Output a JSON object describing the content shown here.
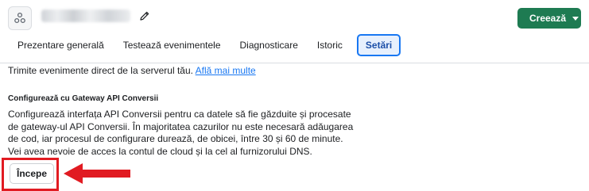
{
  "header": {
    "app_icon": "dataset-hub-icon",
    "edit_icon": "pencil-icon",
    "create_label": "Creează",
    "create_icon": "caret-down-icon"
  },
  "tabs": [
    {
      "label": "Prezentare generală",
      "active": false
    },
    {
      "label": "Testează evenimentele",
      "active": false
    },
    {
      "label": "Diagnosticare",
      "active": false
    },
    {
      "label": "Istoric",
      "active": false
    },
    {
      "label": "Setări",
      "active": true
    }
  ],
  "content": {
    "intro_text": "Trimite evenimente direct de la serverul tău.",
    "learn_more": "Află mai multe",
    "section_title": "Configurează cu Gateway API Conversii",
    "section_desc": "Configurează interfața API Conversii pentru ca datele să fie găzduite și procesate de gateway-ul API Conversii. În majoritatea cazurilor nu este necesară adăugarea de cod, iar procesul de configurare durează, de obicei, între 30 și 60 de minute. Vei avea nevoie de acces la contul de cloud și la cel al furnizorului DNS.",
    "start_label": "Începe"
  },
  "annotation": {
    "color": "#e11b22",
    "arrow_icon": "arrow-left-icon"
  },
  "colors": {
    "primary_green": "#1e7b52",
    "link_blue": "#1877f2",
    "active_tab_bg": "#e7f0fd"
  }
}
